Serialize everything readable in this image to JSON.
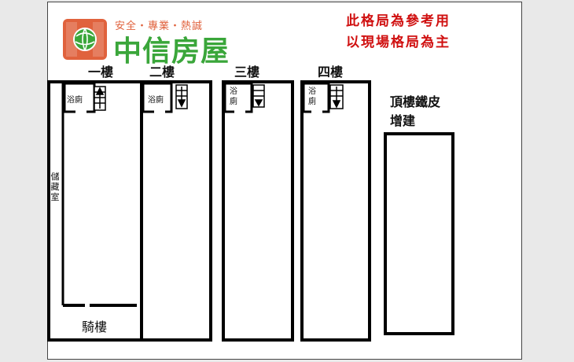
{
  "logo": {
    "slogan": "安全・專業・熱誠",
    "name": "中信房屋",
    "brand_color": "#3aa63a",
    "accent_color": "#e0623d",
    "icon": "globe-house-icon"
  },
  "notice": {
    "line1": "此格局為參考用",
    "line2": "以現場格局為主",
    "color": "#d01010"
  },
  "floors": {
    "f1": "一樓",
    "f2": "二樓",
    "f3": "三樓",
    "f4": "四樓",
    "roof_line1": "頂樓鐵皮",
    "roof_line2": "增建"
  },
  "rooms": {
    "bathroom": "浴廁",
    "storage": "儲藏室",
    "arcade": "騎樓"
  }
}
